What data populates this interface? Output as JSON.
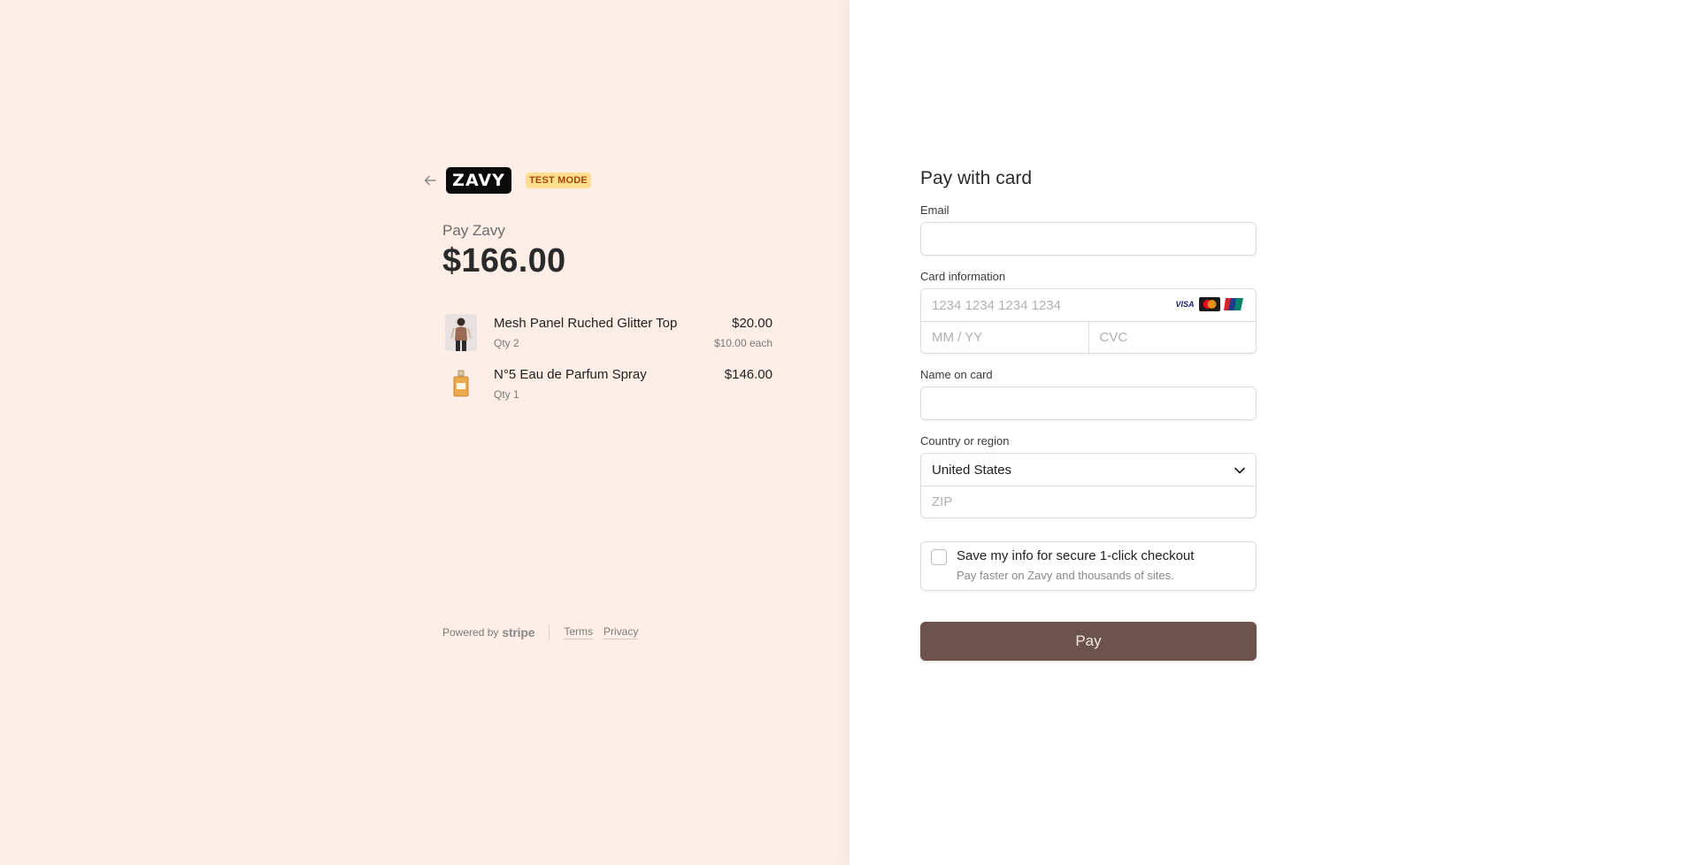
{
  "merchant": {
    "logo_text": "ZAVY",
    "test_badge": "TEST MODE",
    "pay_label": "Pay Zavy",
    "amount": "$166.00"
  },
  "items": [
    {
      "name": "Mesh Panel Ruched Glitter Top",
      "qty": "Qty 2",
      "price": "$20.00",
      "each": "$10.00 each",
      "thumb_icon": "clothing-model-photo"
    },
    {
      "name": "N°5 Eau de Parfum Spray",
      "qty": "Qty 1",
      "price": "$146.00",
      "each": "",
      "thumb_icon": "perfume-bottle-photo"
    }
  ],
  "footer": {
    "powered_by": "Powered by",
    "stripe": "stripe",
    "terms": "Terms",
    "privacy": "Privacy"
  },
  "form": {
    "title": "Pay with card",
    "email_label": "Email",
    "email_value": "",
    "card_label": "Card information",
    "card_number_placeholder": "1234 1234 1234 1234",
    "expiry_placeholder": "MM / YY",
    "cvc_placeholder": "CVC",
    "card_brands": [
      "VISA",
      "mastercard",
      "UnionPay"
    ],
    "name_label": "Name on card",
    "name_value": "",
    "country_label": "Country or region",
    "country_value": "United States",
    "zip_placeholder": "ZIP",
    "save_title": "Save my info for secure 1-click checkout",
    "save_subtitle": "Pay faster on Zavy and thousands of sites.",
    "save_checked": false,
    "pay_button": "Pay"
  },
  "colors": {
    "left_background": "#fdeee7",
    "pay_button": "#6b534b",
    "test_badge_bg": "#ffde92",
    "test_badge_text": "#a2470c"
  }
}
